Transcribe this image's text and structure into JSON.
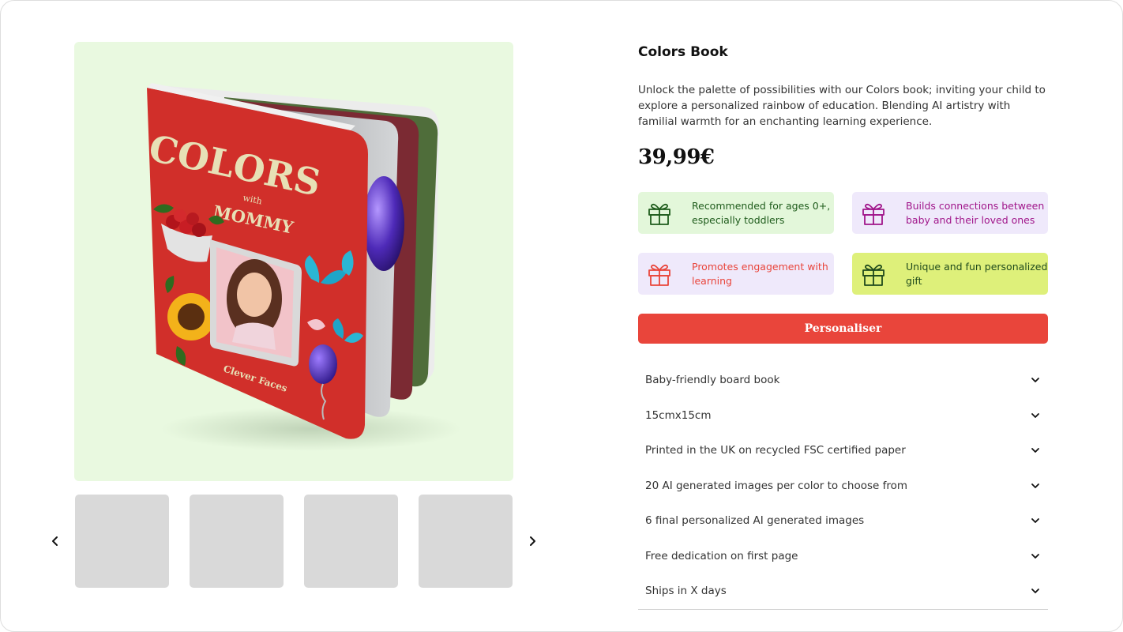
{
  "product": {
    "title": "Colors Book",
    "description": "Unlock the palette of possibilities with our Colors book; inviting your child to explore a personalized rainbow of education. Blending AI artistry with familial warmth for an enchanting learning experience.",
    "price": "39,99€"
  },
  "cover": {
    "title": "COLORS",
    "with": "with",
    "subtitle": "MOMMY",
    "brand": "Clever Faces"
  },
  "features": [
    {
      "text": "Recommended for ages 0+, especially toddlers",
      "icon": "gift-icon",
      "bg": "#e3f7da",
      "fg": "#1f5c1c"
    },
    {
      "text": "Builds connections between baby and their loved ones",
      "icon": "gift-icon",
      "bg": "#efe9fb",
      "fg": "#a0158a"
    },
    {
      "text": "Promotes engagement with learning",
      "icon": "gift-icon",
      "bg": "#efe9fb",
      "fg": "#e9453b"
    },
    {
      "text": "Unique and fun personalized gift",
      "icon": "gift-icon",
      "bg": "#def07a",
      "fg": "#1f4a1c"
    }
  ],
  "cta": {
    "label": "Personaliser"
  },
  "accordion": [
    {
      "label": "Baby-friendly board book"
    },
    {
      "label": "15cmx15cm"
    },
    {
      "label": "Printed in the UK on recycled FSC certified paper"
    },
    {
      "label": "20 AI generated images per color to choose from"
    },
    {
      "label": "6 final personalized AI generated images"
    },
    {
      "label": "Free dedication on first page"
    },
    {
      "label": "Ships in X days"
    }
  ],
  "gallery": {
    "thumbnail_count": 4,
    "prev_icon": "chevron-left-icon",
    "next_icon": "chevron-right-icon"
  },
  "colors": {
    "accent": "#e9453b",
    "hero_bg": "#e9f9e0",
    "book_red": "#d12f2a",
    "thumb_placeholder": "#d9d9d9"
  }
}
